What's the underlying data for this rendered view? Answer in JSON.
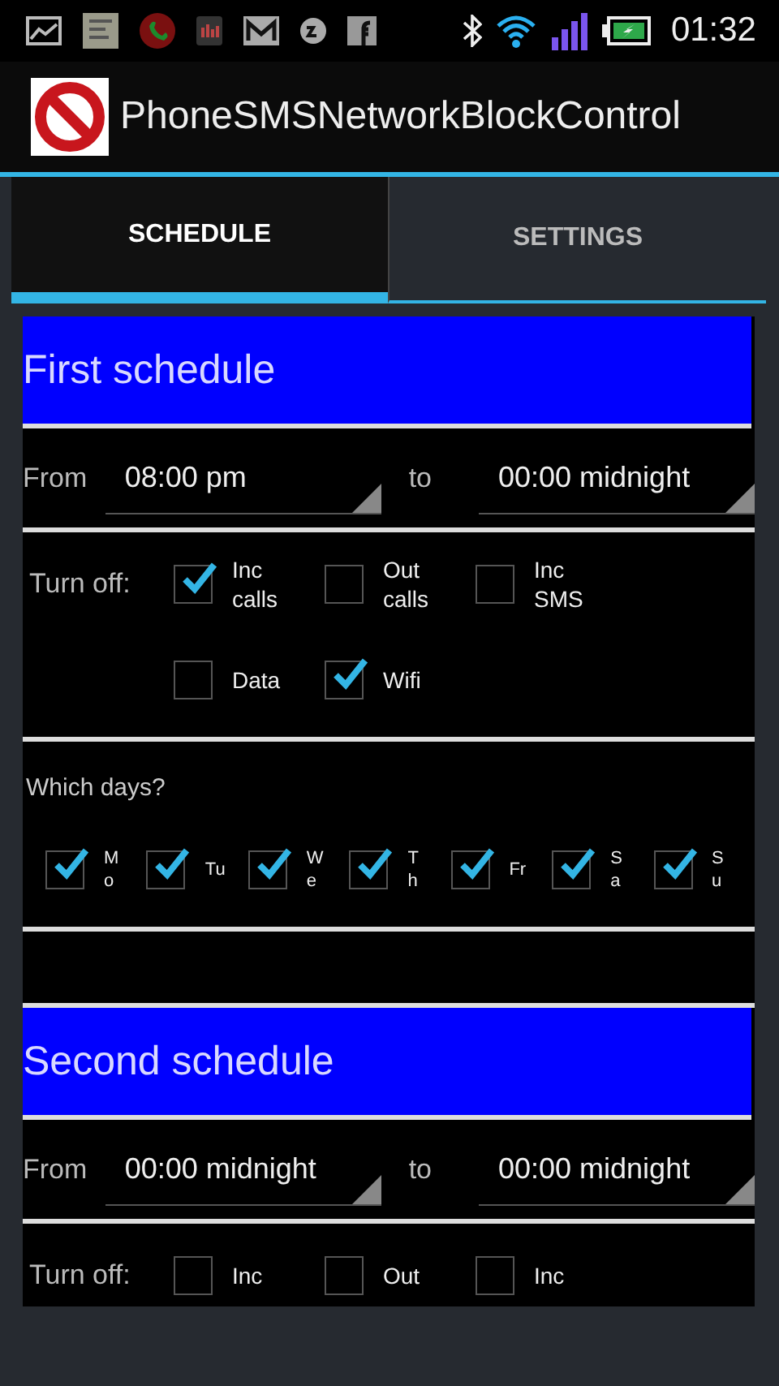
{
  "status_bar": {
    "time": "01:32"
  },
  "action_bar": {
    "title": "PhoneSMSNetworkBlockControl"
  },
  "tabs": [
    {
      "label": "SCHEDULE",
      "selected": true
    },
    {
      "label": "SETTINGS",
      "selected": false
    }
  ],
  "schedules": [
    {
      "title": "First schedule",
      "from_label": "From",
      "from": "08:00 pm",
      "to_label": "to",
      "to": "00:00 midnight",
      "turn_off_label": "Turn off:",
      "turn_off": [
        {
          "label": "Inc calls",
          "checked": true
        },
        {
          "label": "Out calls",
          "checked": false
        },
        {
          "label": "Inc SMS",
          "checked": false
        },
        {
          "label": "Data",
          "checked": false
        },
        {
          "label": "Wifi",
          "checked": true
        }
      ],
      "days_label": "Which days?",
      "days": [
        {
          "label": "M\no",
          "checked": true
        },
        {
          "label": "Tu",
          "checked": true
        },
        {
          "label": "W\ne",
          "checked": true
        },
        {
          "label": "T\nh",
          "checked": true
        },
        {
          "label": "Fr",
          "checked": true
        },
        {
          "label": "S\na",
          "checked": true
        },
        {
          "label": "S\nu",
          "checked": true
        }
      ]
    },
    {
      "title": "Second schedule",
      "from_label": "From",
      "from": "00:00 midnight",
      "to_label": "to",
      "to": "00:00 midnight",
      "turn_off_label": "Turn off:",
      "turn_off": [
        {
          "label": "Inc",
          "checked": false
        },
        {
          "label": "Out",
          "checked": false
        },
        {
          "label": "Inc",
          "checked": false
        }
      ]
    }
  ]
}
